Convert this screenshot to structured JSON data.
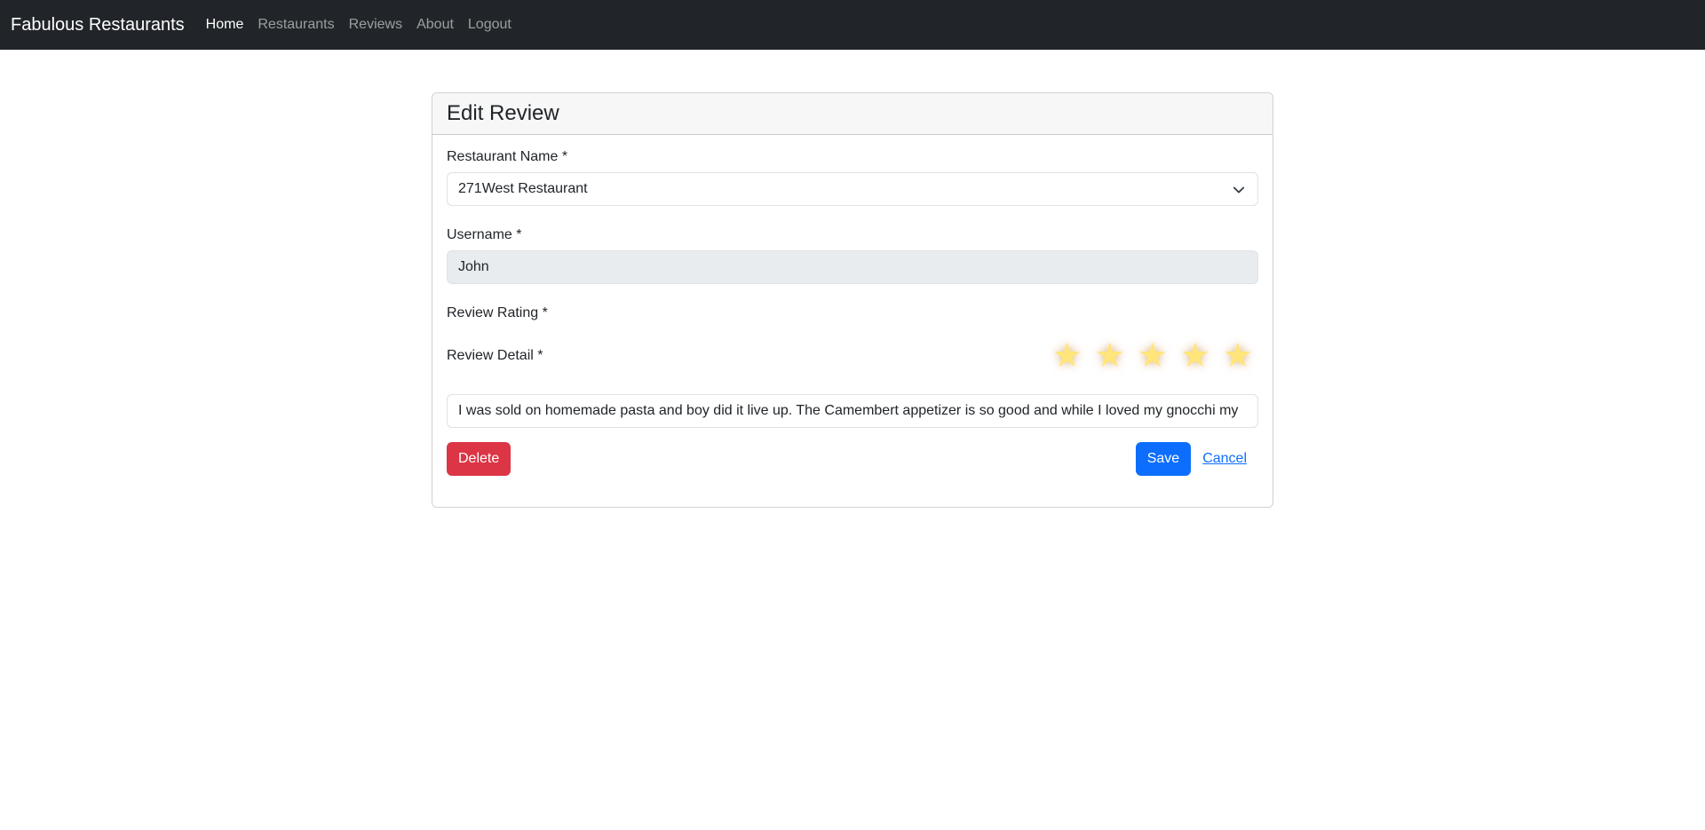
{
  "navbar": {
    "brand": "Fabulous Restaurants",
    "links": [
      {
        "label": "Home",
        "active": true
      },
      {
        "label": "Restaurants",
        "active": false
      },
      {
        "label": "Reviews",
        "active": false
      },
      {
        "label": "About",
        "active": false
      },
      {
        "label": "Logout",
        "active": false
      }
    ]
  },
  "form": {
    "title": "Edit Review",
    "restaurant_label": "Restaurant Name *",
    "restaurant_value": "271West Restaurant",
    "username_label": "Username *",
    "username_value": "John",
    "rating_label": "Review Rating *",
    "rating_value": 5,
    "rating_max": 5,
    "detail_label": "Review Detail *",
    "detail_value": "I was sold on homemade pasta and boy did it live up. The Camembert appetizer is so good and while I loved my gnocchi my",
    "delete_label": "Delete",
    "save_label": "Save",
    "cancel_label": "Cancel"
  },
  "colors": {
    "navbar": "#212529",
    "danger": "#dc3545",
    "primary": "#0d6efd",
    "star": "#ffe57a"
  }
}
